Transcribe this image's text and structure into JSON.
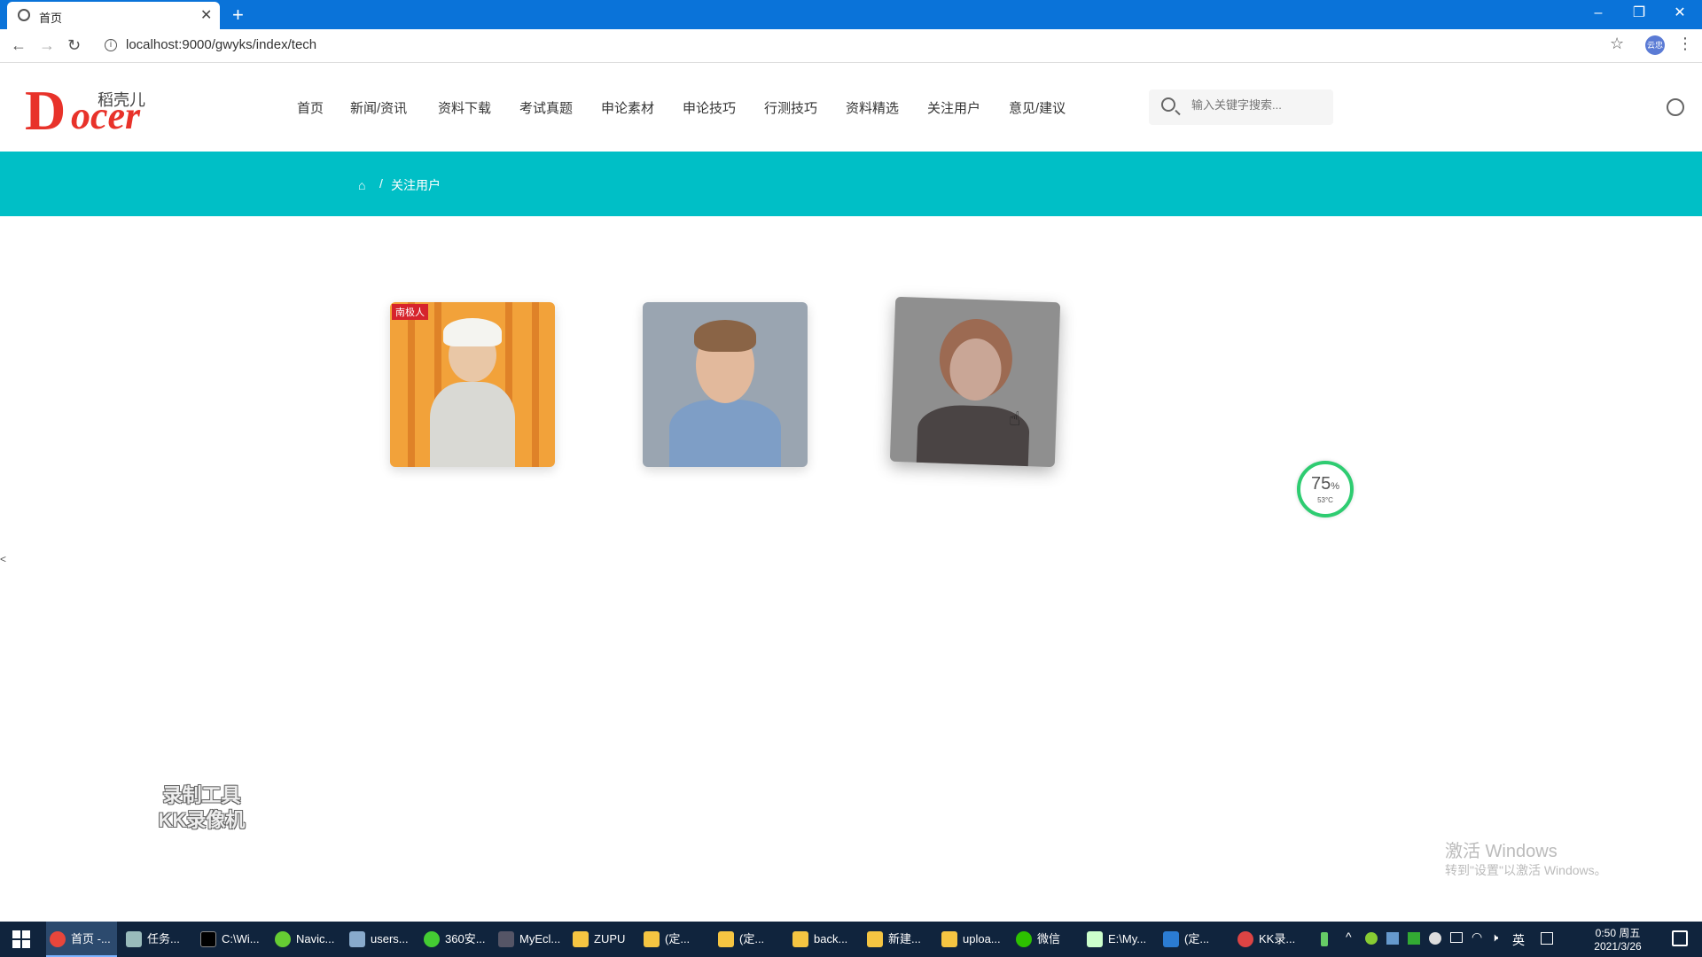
{
  "browser": {
    "tab_title": "首页",
    "url": "localhost:9000/gwyks/index/tech",
    "profile_label": "云忠"
  },
  "site": {
    "logo_cn": "稻壳儿",
    "logo_d": "D",
    "logo_rest": "ocer",
    "nav": [
      "首页",
      "新闻/资讯",
      "资料下载",
      "考试真题",
      "申论素材",
      "申论技巧",
      "行测技巧",
      "资料精选",
      "关注用户",
      "意见/建议"
    ],
    "search_placeholder": "输入关键字搜索..."
  },
  "breadcrumb": {
    "separator": "/",
    "current": "关注用户"
  },
  "cards": [
    {
      "badge": "南极人",
      "name": ""
    },
    {
      "name": ""
    },
    {
      "name": ""
    }
  ],
  "widget": {
    "percent": "75",
    "unit": "%",
    "temp": "53°C"
  },
  "watermark": {
    "line1": "录制工具",
    "line2": "KK录像机"
  },
  "windows_activation": {
    "title": "激活 Windows",
    "subtitle": "转到\"设置\"以激活 Windows。"
  },
  "taskbar": {
    "items": [
      "首页 -...",
      "任务...",
      "C:\\Wi...",
      "Navic...",
      "users...",
      "360安...",
      "MyEcl...",
      "ZUPU",
      "(定...",
      "(定...",
      "back...",
      "新建...",
      "uploa...",
      "微信",
      "E:\\My...",
      "(定...",
      "KK录..."
    ],
    "lang": "英",
    "time": "0:50 周五",
    "date": "2021/3/26"
  },
  "colors": {
    "titlebar": "#0a73d9",
    "banner": "#00bfc6",
    "logo": "#e8322a",
    "taskbar": "#10243d"
  }
}
